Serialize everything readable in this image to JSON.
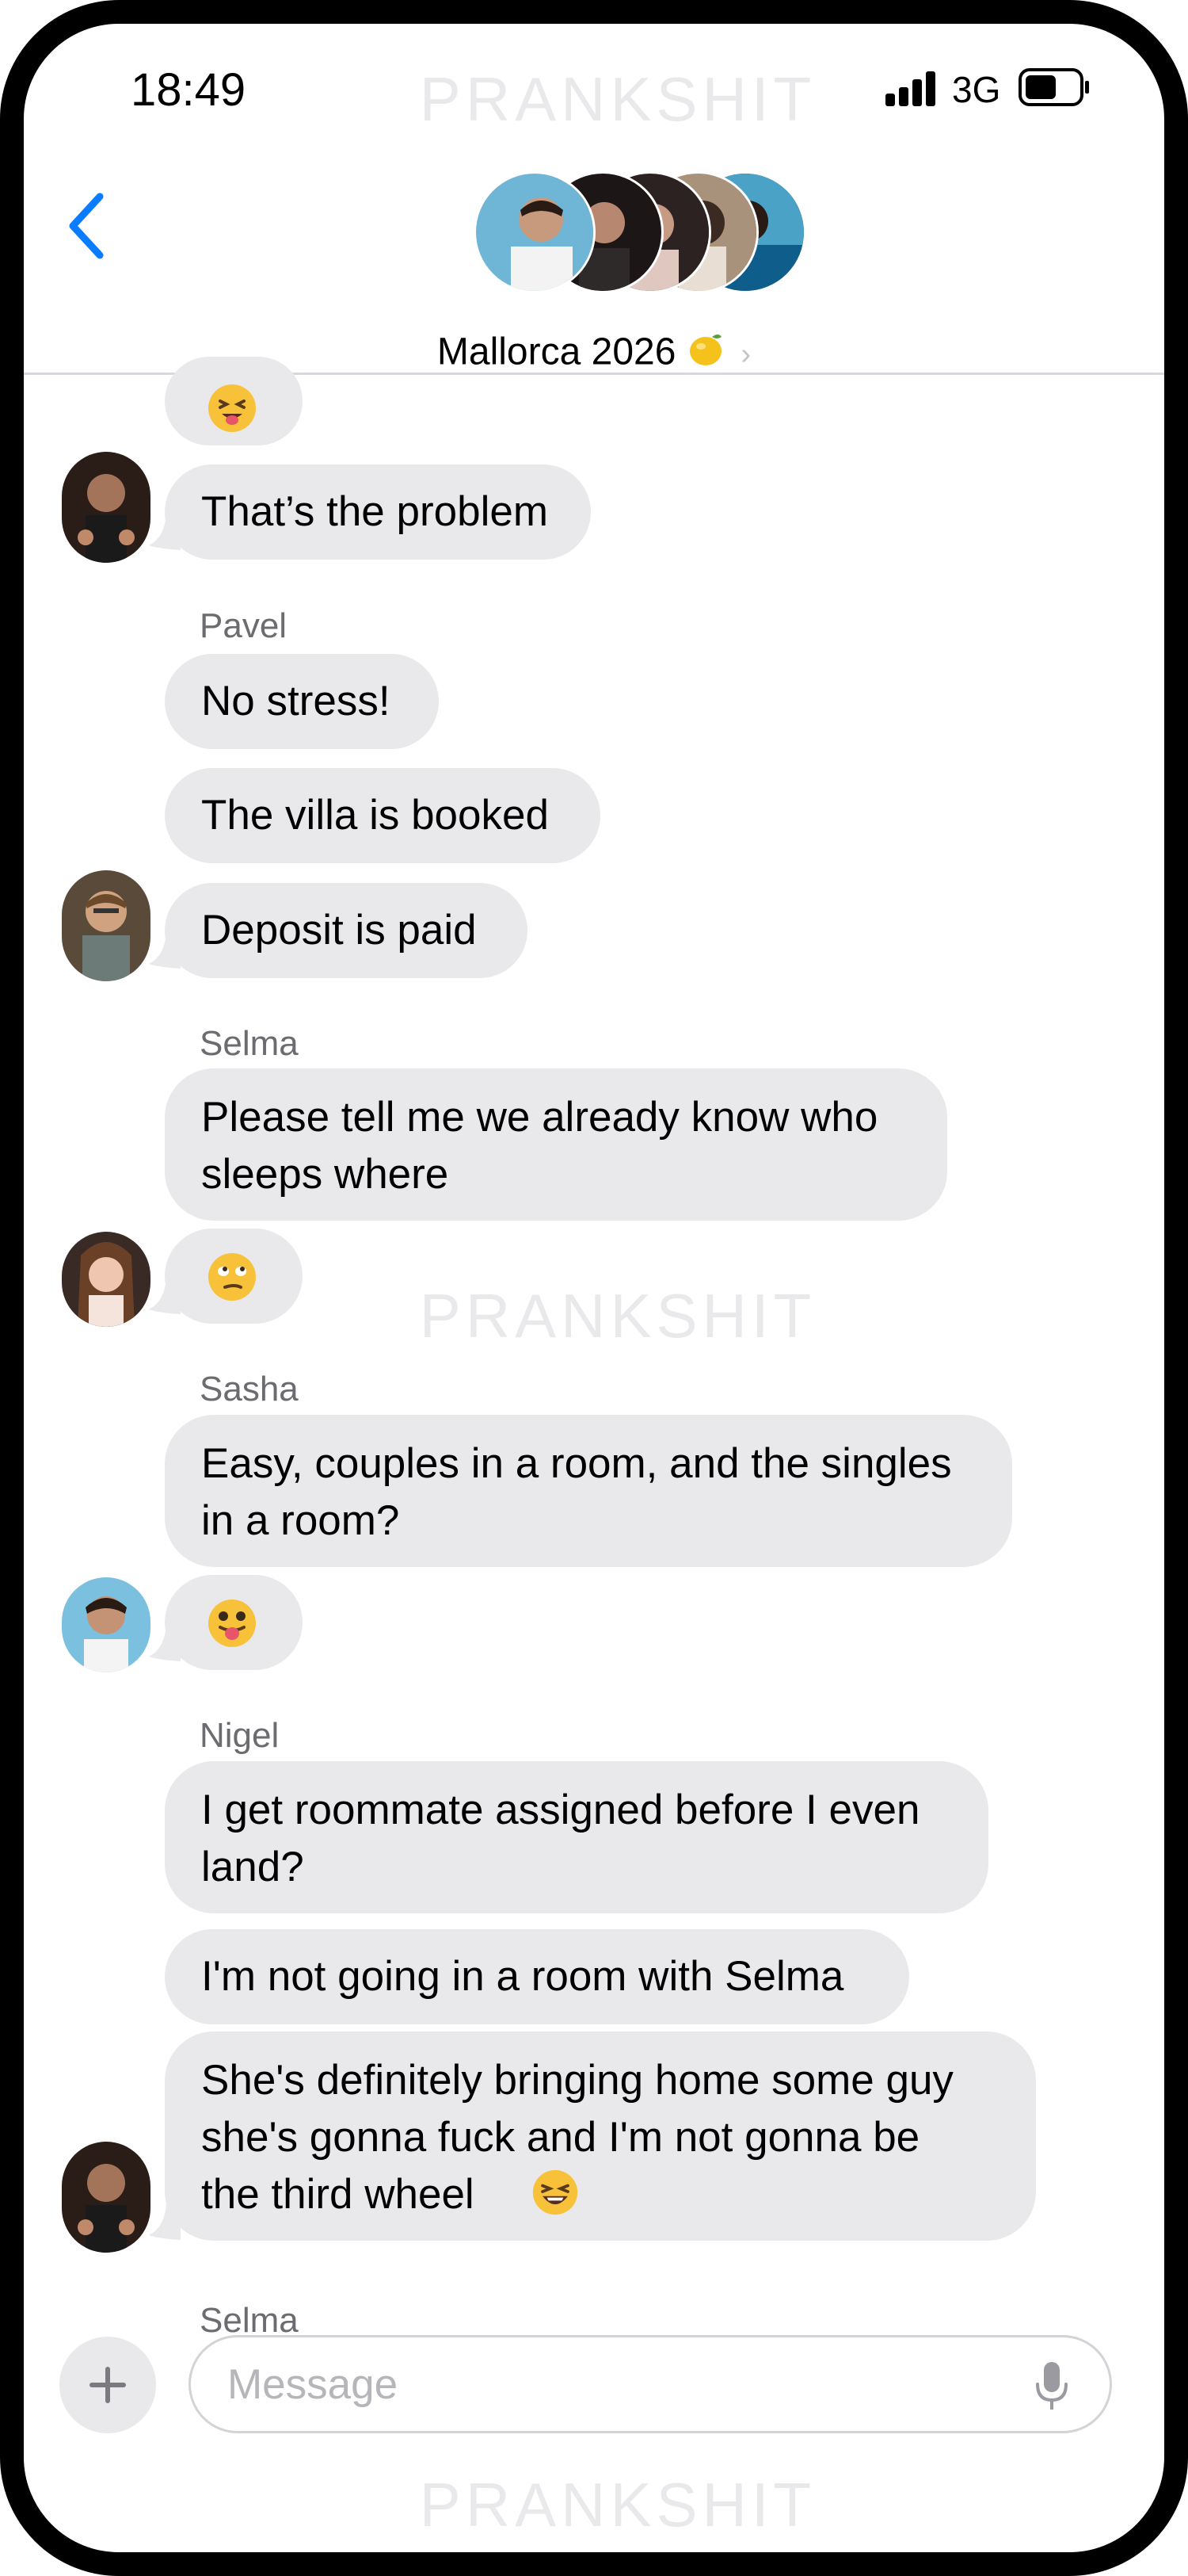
{
  "watermark": "PRANKSHIT",
  "status_bar": {
    "time": "18:49",
    "network": "3G"
  },
  "header": {
    "group_name": "Mallorca 2026"
  },
  "messages": {
    "m0_emoji": "squinting-tongue-emoji",
    "m1": "That’s the problem",
    "sender_pavel": "Pavel",
    "m2": "No stress!",
    "m3": "The villa is booked",
    "m4": "Deposit is paid",
    "sender_selma_1": "Selma",
    "m5": "Please tell me we already know who\nsleeps where",
    "m6_emoji": "relieved-eye-roll-emoji",
    "sender_sasha": "Sasha",
    "m7": "Easy, couples in a room, and the singles\nin a room?",
    "m8_emoji": "zany-tongue-emoji",
    "sender_nigel": "Nigel",
    "m9": "I get roommate assigned before I even\nland?",
    "m10": "I'm not going in a room with Selma",
    "m11": "She's definitely bringing home some guy\nshe's gonna fuck and I'm not gonna be\nthe third wheel",
    "sender_selma_2": "Selma"
  },
  "composer": {
    "placeholder": "Message"
  },
  "colors": {
    "accent": "#0a7cff",
    "bubble": "#e9e9eb",
    "sender": "#6b6b70"
  }
}
